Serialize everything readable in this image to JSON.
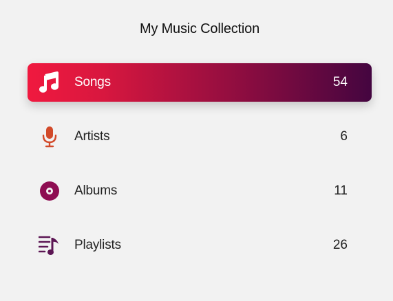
{
  "title": "My Music Collection",
  "colors": {
    "background": "#f2f2f2",
    "active_gradient_start": "#f0193f",
    "active_gradient_end": "#440540",
    "artists_icon": "#d24a2a",
    "albums_icon": "#8e0d52",
    "playlists_icon": "#5c1654"
  },
  "items": [
    {
      "label": "Songs",
      "count": "54",
      "icon": "music-note-icon",
      "active": true
    },
    {
      "label": "Artists",
      "count": "6",
      "icon": "microphone-icon",
      "active": false
    },
    {
      "label": "Albums",
      "count": "11",
      "icon": "vinyl-record-icon",
      "active": false
    },
    {
      "label": "Playlists",
      "count": "26",
      "icon": "playlist-icon",
      "active": false
    }
  ]
}
